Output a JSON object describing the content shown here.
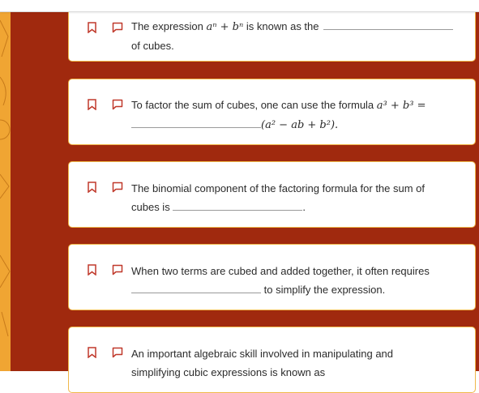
{
  "questions": [
    {
      "before": "The expression ",
      "math": "aⁿ + bⁿ",
      "middle": " is known as the",
      "after": "of cubes."
    },
    {
      "before": "To factor the sum of cubes, one can use the formula ",
      "math": "a³ + b³ =",
      "after": "(a² − ab + b²)."
    },
    {
      "line1": "The binomial component of the factoring formula for the sum of",
      "before": "cubes is",
      "after": "."
    },
    {
      "line1": "When two terms are cubed and added together, it often requires",
      "after": "to simplify the expression."
    },
    {
      "line1": "An important algebraic skill involved in manipulating and",
      "line2": "simplifying cubic expressions is known as"
    }
  ],
  "colors": {
    "panel": "#a0290e",
    "accent": "#f0a533",
    "card_border": "#f0b84a",
    "icon": "#c0392b"
  },
  "icons": {
    "bookmark": "bookmark-icon",
    "comment": "comment-icon"
  }
}
